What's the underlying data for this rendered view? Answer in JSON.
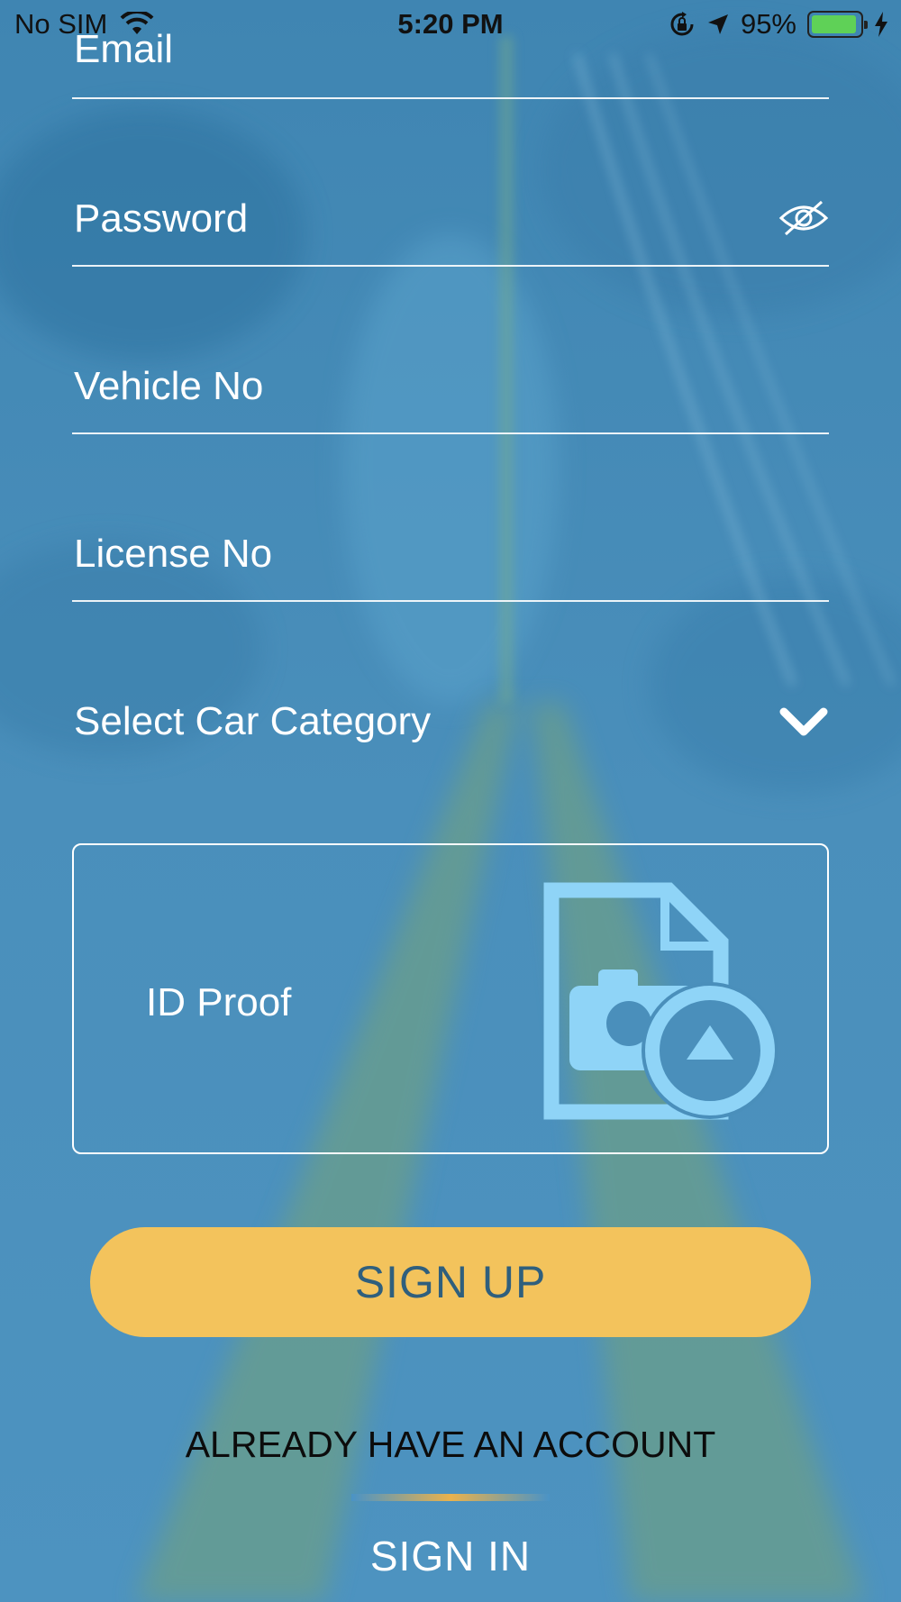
{
  "status_bar": {
    "carrier": "No SIM",
    "time": "5:20 PM",
    "battery": "95%",
    "battery_level": 0.95
  },
  "form": {
    "email_placeholder": "Email",
    "password_placeholder": "Password",
    "vehicle_placeholder": "Vehicle No",
    "license_placeholder": "License No",
    "car_category_placeholder": "Select Car Category",
    "id_proof_label": "ID Proof"
  },
  "actions": {
    "sign_up": "SIGN UP",
    "already_account": "ALREADY HAVE AN ACCOUNT",
    "sign_in": "SIGN IN"
  },
  "icons": {
    "wifi": "wifi-icon",
    "orientation_lock": "orientation-lock-icon",
    "location": "location-arrow-icon",
    "charging": "charging-bolt-icon",
    "password_visibility": "eye-slash-icon",
    "dropdown": "chevron-down-icon",
    "upload": "document-camera-upload-icon"
  },
  "colors": {
    "background": "#4a8fbb",
    "road": "#6a9e8a",
    "accent_button": "#f3c35c",
    "button_text": "#2f5f7d",
    "upload_icon": "#8fd4f7",
    "battery_fill": "#5fd157"
  }
}
